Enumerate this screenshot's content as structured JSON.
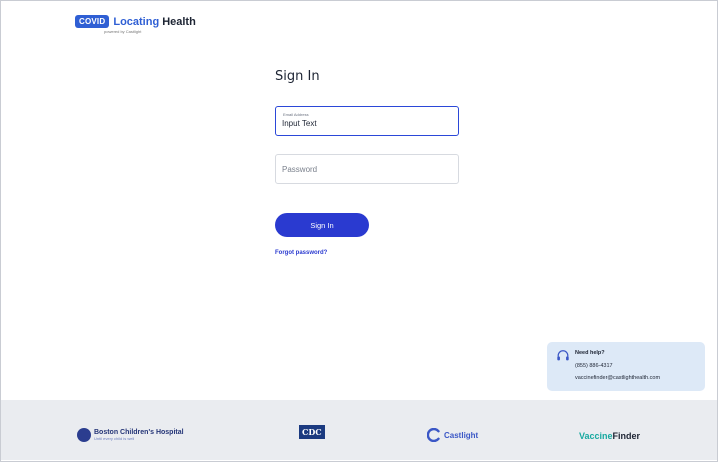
{
  "brand": {
    "badge": "COVID",
    "locating": "Locating",
    "health": "Health",
    "powered_by": "powered by Castlight",
    "accent": "#2f5fd4"
  },
  "signin": {
    "title": "Sign In",
    "email_label": "Email Address",
    "email_value": "Input Text",
    "password_placeholder": "Password",
    "button": "Sign In",
    "forgot": "Forgot password?",
    "button_color": "#2a3ad0"
  },
  "help": {
    "title": "Need help?",
    "phone": "(855) 886-4317",
    "email": "vaccinefinder@castlighthealth.com",
    "icon": "headset-icon"
  },
  "footer": {
    "bch_name": "Boston Children's Hospital",
    "bch_tagline": "Until every child is well",
    "cdc": "CDC",
    "castlight": "Castlight",
    "vf_part1": "Vaccine",
    "vf_part2": "Finder"
  }
}
